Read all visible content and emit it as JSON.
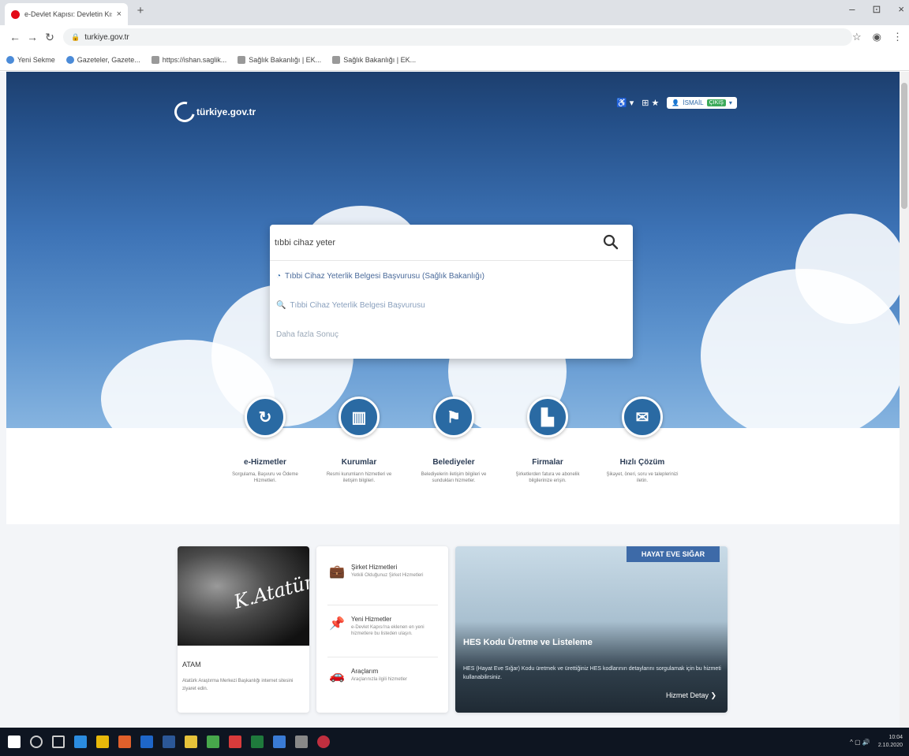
{
  "browser": {
    "tab_title": "e-Devlet Kapısı: Devletin Kısayol...",
    "tab_close": "×",
    "new_tab": "+",
    "window_controls": [
      "–",
      "⊡",
      "×"
    ],
    "url": "turkiye.gov.tr",
    "bookmarks": [
      {
        "label": "Yeni Sekme",
        "icon": "globe-icon"
      },
      {
        "label": "Gazeteler, Gazete...",
        "icon": "globe-icon"
      },
      {
        "label": "https://ishan.saglik...",
        "icon": "page-icon"
      },
      {
        "label": "Sağlık Bakanlığı | EK...",
        "icon": "page-icon"
      },
      {
        "label": "Sağlık Bakanlığı | EK...",
        "icon": "page-icon"
      }
    ]
  },
  "header": {
    "logo_text": "türkiye.gov.tr",
    "accessibility": "♿ ▾",
    "language": "⊞ ★",
    "user_name": "İSMAİL",
    "user_tag": "ÇIKIŞ"
  },
  "search": {
    "query": "tıbbi cihaz yeter",
    "suggestions": [
      {
        "label": "Tıbbi Cihaz Yeterlik Belgesi Başvurusu (Sağlık Bakanlığı)",
        "icon": "edevlet-icon"
      },
      {
        "label": "Tıbbi Cihaz Yeterlik Belgesi Başvurusu",
        "icon": "search-icon"
      },
      {
        "label": "Daha fazla Sonuç",
        "icon": ""
      }
    ]
  },
  "categories": [
    {
      "title": "e-Hizmetler",
      "desc": "Sorgulama, Başvuru ve Ödeme Hizmetleri.",
      "icon": "refresh-icon"
    },
    {
      "title": "Kurumlar",
      "desc": "Resmi kurumların hizmetleri ve iletişim bilgileri.",
      "icon": "building-icon"
    },
    {
      "title": "Belediyeler",
      "desc": "Belediyelerin iletişim bilgileri ve sundukları hizmetler.",
      "icon": "signpost-icon"
    },
    {
      "title": "Firmalar",
      "desc": "Şirketlerden fatura ve abonelik bilgilerinize erişin.",
      "icon": "factory-icon"
    },
    {
      "title": "Hızlı Çözüm",
      "desc": "Şikayet, öneri, soru ve taleplerinizi iletin.",
      "icon": "chat-icon"
    }
  ],
  "cards": {
    "atam": {
      "title": "ATAM",
      "desc": "Atatürk Araştırma Merkezi Başkanlığı internet sitesini ziyaret edin."
    },
    "services": [
      {
        "title": "Şirket Hizmetleri",
        "desc": "Yetkili Olduğunuz Şirket Hizmetleri",
        "icon": "briefcase-icon"
      },
      {
        "title": "Yeni Hizmetler",
        "desc": "e-Devlet Kapısı'na eklenen en yeni hizmetlere bu listeden ulaşın.",
        "icon": "pin-icon"
      },
      {
        "title": "Araçlarım",
        "desc": "Araçlarınızla ilgili hizmetler",
        "icon": "car-icon"
      }
    ],
    "hes": {
      "banner": "HAYAT EVE SIĞAR",
      "title": "HES Kodu Üretme ve Listeleme",
      "desc": "HES (Hayat Eve Sığar) Kodu üretmek ve ürettiğiniz HES kodlarının detaylarını sorgulamak için bu hizmeti kullanabilirsiniz.",
      "link": "Hizmet Detay ❯"
    }
  },
  "taskbar": {
    "time": "10:04",
    "date": "2.10.2020",
    "tray": "^ ▢ 🔊"
  },
  "colors": {
    "brand_blue": "#2a6aa3",
    "hero_dark": "#1d3f6e",
    "hero_light": "#86b4e0",
    "taskbar": "#0e1521"
  }
}
